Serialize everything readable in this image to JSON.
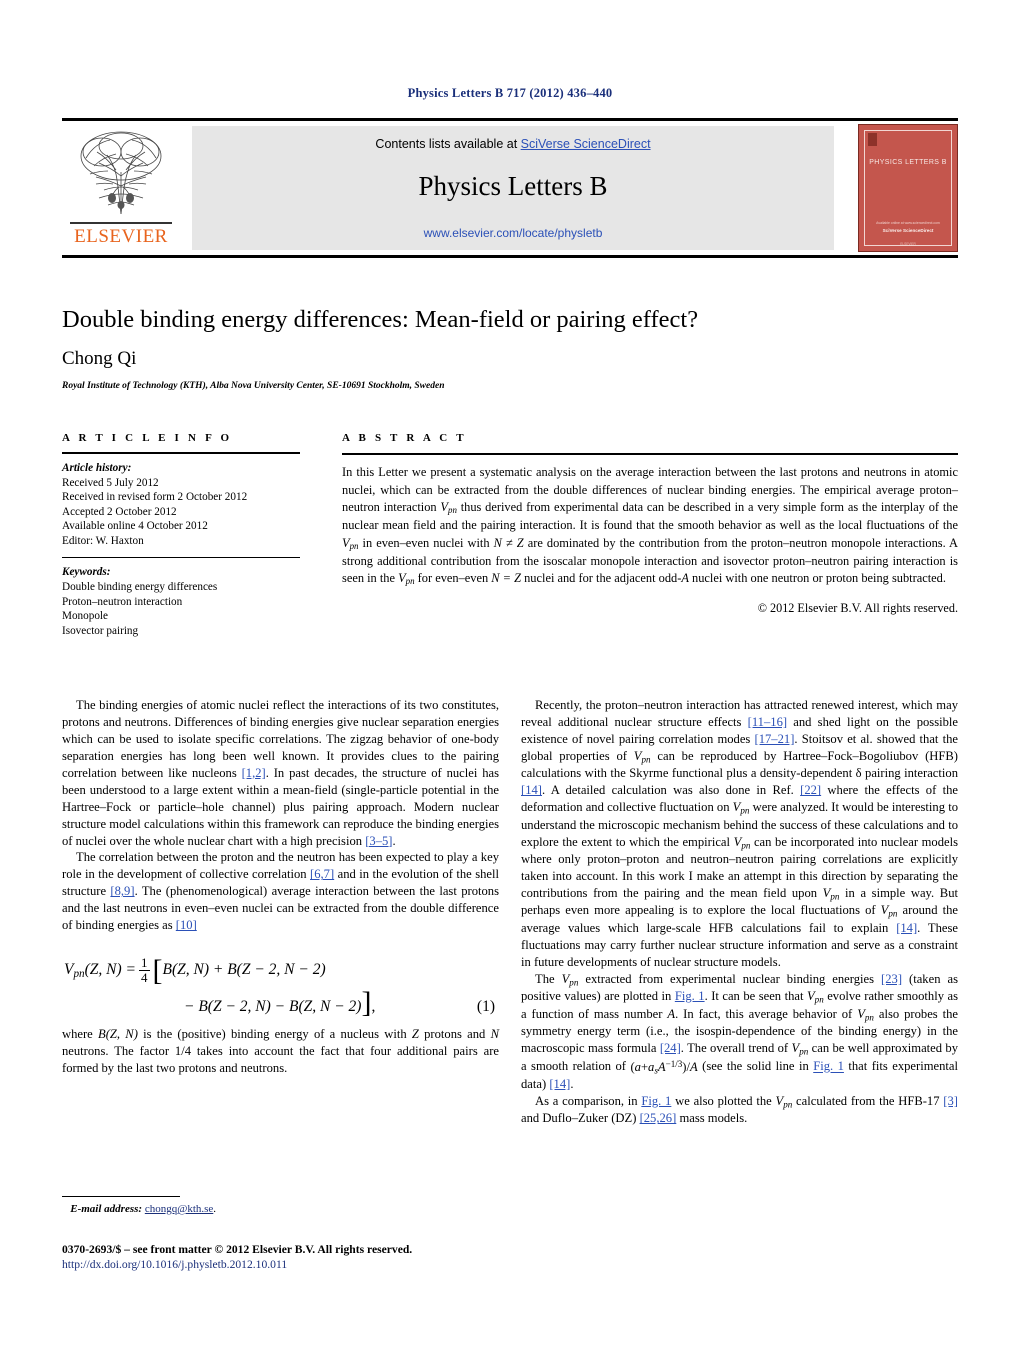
{
  "journal_ref": "Physics Letters B 717 (2012) 436–440",
  "masthead": {
    "contents_prefix": "Contents lists available at ",
    "contents_link": "SciVerse ScienceDirect",
    "journal_name": "Physics Letters B",
    "url": "www.elsevier.com/locate/physletb",
    "publisher": "ELSEVIER",
    "cover": {
      "title": "PHYSICS LETTERS B",
      "foot1": "Available online at www.sciencedirect.com",
      "foot2": "SciVerse ScienceDirect",
      "foot3": "ELSEVIER"
    }
  },
  "article": {
    "title": "Double binding energy differences: Mean-field or pairing effect?",
    "author": "Chong Qi",
    "affiliation": "Royal Institute of Technology (KTH), Alba Nova University Center, SE-10691 Stockholm, Sweden"
  },
  "info": {
    "heading": "A R T I C L E    I N F O",
    "history_label": "Article history:",
    "history": [
      "Received 5 July 2012",
      "Received in revised form 2 October 2012",
      "Accepted 2 October 2012",
      "Available online 4 October 2012",
      "Editor: W. Haxton"
    ],
    "keywords_label": "Keywords:",
    "keywords": [
      "Double binding energy differences",
      "Proton–neutron interaction",
      "Monopole",
      "Isovector pairing"
    ]
  },
  "abstract": {
    "heading": "A B S T R A C T",
    "p1_a": "In this Letter we present a systematic analysis on the average interaction between the last protons and neutrons in atomic nuclei, which can be extracted from the double differences of nuclear binding energies. The empirical average proton–neutron interaction ",
    "vpn": "V",
    "pn": "pn",
    "p1_b": " thus derived from experimental data can be described in a very simple form as the interplay of the nuclear mean field and the pairing interaction. It is found that the smooth behavior as well as the local fluctuations of the ",
    "p1_c": " in even–even nuclei with ",
    "nnez": "N ≠ Z",
    "p1_d": " are dominated by the contribution from the proton–neutron monopole interactions. A strong additional contribution from the isoscalar monopole interaction and isovector proton–neutron pairing interaction is seen in the ",
    "p1_e": " for even–even ",
    "neqz": "N = Z",
    "p1_f": " nuclei and for the adjacent odd-",
    "oddA": "A",
    "p1_g": " nuclei with one neutron or proton being subtracted.",
    "copyright": "© 2012 Elsevier B.V. All rights reserved."
  },
  "body": {
    "left": {
      "p1_a": "The binding energies of atomic nuclei reflect the interactions of its two constitutes, protons and neutrons. Differences of binding energies give nuclear separation energies which can be used to isolate specific correlations. The zigzag behavior of one-body separation energies has long been well known. It provides clues to the pairing correlation between like nucleons ",
      "p1_cite1": "[1,2]",
      "p1_b": ". In past decades, the structure of nuclei has been understood to a large extent within a mean-field (single-particle potential in the Hartree–Fock or particle–hole channel) plus pairing approach. Modern nuclear structure model calculations within this framework can reproduce the binding energies of nuclei over the whole nuclear chart with a high precision ",
      "p1_cite2": "[3–5]",
      "p1_c": ".",
      "p2_a": "The correlation between the proton and the neutron has been expected to play a key role in the development of collective correlation ",
      "p2_cite1": "[6,7]",
      "p2_b": " and in the evolution of the shell structure ",
      "p2_cite2": "[8,9]",
      "p2_c": ". The (phenomenological) average interaction between the last protons and the last neutrons in even–even nuclei can be extracted from the double difference of binding energies as ",
      "p2_cite3": "[10]",
      "p3_a": "where ",
      "p3_bzn": "B(Z, N)",
      "p3_b": " is the (positive) binding energy of a nucleus with ",
      "p3_z": "Z",
      "p3_c": " protons and ",
      "p3_n": "N",
      "p3_d": " neutrons. The factor 1/4 takes into account the fact that four additional pairs are formed by the last two protons and neutrons."
    },
    "right": {
      "p1_a": "Recently, the proton–neutron interaction has attracted renewed interest, which may reveal additional nuclear structure effects ",
      "p1_cite1": "[11–16]",
      "p1_b": " and shed light on the possible existence of novel pairing correlation modes ",
      "p1_cite2": "[17–21]",
      "p1_c": ". Stoitsov et al. showed that the global properties of ",
      "p1_d": " can be reproduced by Hartree–Fock–Bogoliubov (HFB) calculations with the Skyrme functional plus a density-dependent δ pairing interaction ",
      "p1_cite3": "[14]",
      "p1_e": ". A detailed calculation was also done in Ref. ",
      "p1_cite4": "[22]",
      "p1_f": " where the effects of the deformation and collective fluctuation on ",
      "p1_g": " were analyzed. It would be interesting to understand the microscopic mechanism behind the success of these calculations and to explore the extent to which the empirical ",
      "p1_h": " can be incorporated into nuclear models where only proton–proton and neutron–neutron pairing correlations are explicitly taken into account. In this work I make an attempt in this direction by separating the contributions from the pairing and the mean field upon ",
      "p1_i": " in a simple way. But perhaps even more appealing is to explore the local fluctuations of ",
      "p1_j": " around the average values which large-scale HFB calculations fail to explain ",
      "p1_cite5": "[14]",
      "p1_k": ". These fluctuations may carry further nuclear structure information and serve as a constraint in future developments of nuclear structure models.",
      "p2_a": "The ",
      "p2_b": " extracted from experimental nuclear binding energies ",
      "p2_cite1": "[23]",
      "p2_c": " (taken as positive values) are plotted in ",
      "p2_fig1": "Fig. 1",
      "p2_d": ". It can be seen that ",
      "p2_e": " evolve rather smoothly as a function of mass number ",
      "p2_A": "A",
      "p2_f": ". In fact, this average behavior of ",
      "p2_g": " also probes the symmetry energy term (i.e., the isospin-dependence of the binding energy) in the macroscopic mass formula ",
      "p2_cite2": "[24]",
      "p2_h": ". The overall trend of ",
      "p2_i": " can be well approximated by a smooth relation of ",
      "p2_formula": "(a+a A^−1/3)/A",
      "p2_j": " (see the solid line in ",
      "p2_fig2": "Fig. 1",
      "p2_k": " that fits experimental data) ",
      "p2_cite3": "[14]",
      "p2_l": ".",
      "p3_a": "As a comparison, in ",
      "p3_fig1": "Fig. 1",
      "p3_b": " we also plotted the ",
      "p3_c": " calculated from the HFB-17 ",
      "p3_cite1": "[3]",
      "p3_d": " and Duflo–Zuker (DZ) ",
      "p3_cite2": "[25,26]",
      "p3_e": " mass models."
    }
  },
  "equation": {
    "lhs": "V",
    "lhs_sub": "pn",
    "lhs_args": "(Z, N) = ",
    "frac_num": "1",
    "frac_den": "4",
    "line1": "B(Z, N) + B(Z − 2, N − 2)",
    "line2": "− B(Z − 2, N) − B(Z, N − 2)",
    "number": "(1)"
  },
  "footnote": {
    "label": "E-mail address:",
    "email": "chongq@kth.se",
    "trailing": "."
  },
  "footer": {
    "issn_line": "0370-2693/$ – see front matter © 2012 Elsevier B.V. All rights reserved.",
    "doi": "http://dx.doi.org/10.1016/j.physletb.2012.10.011"
  },
  "colors": {
    "link": "#2b50b7",
    "journal_ref": "#1a2f7a",
    "elsevier_orange": "#e8641e",
    "cover_red": "#c4564d"
  }
}
